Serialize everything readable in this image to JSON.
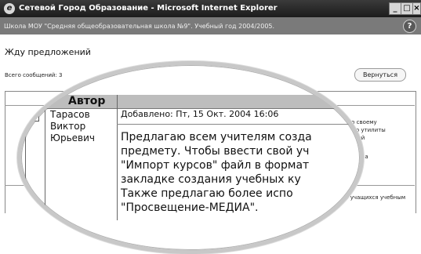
{
  "window": {
    "title": "Сетевой Город Образование - Microsoft Internet Explorer",
    "controls": [
      "_",
      "□",
      "×"
    ]
  },
  "header": {
    "school": "Школа МОУ \"Средняя общеобразовательная школа №9\". Учебный год 2004/2005.",
    "help_label": "?"
  },
  "page": {
    "title": "Жду предложений",
    "message_count": "Всего сообщений: 3",
    "back_label": "Вернуться"
  },
  "table": {
    "author_header": "Автор",
    "row": {
      "author_lines": [
        "Тарасов",
        "Виктор",
        "Юрьевич"
      ],
      "added": "Добавлено: Пт, 15 Окт. 2004 16:06",
      "message_lines": [
        "Предлагаю всем учителям созда",
        "предмету. Чтобы ввести свой уч",
        "\"Импорт курсов\" файл в формат",
        "закладке создания учебных ку",
        "Также предлагаю более испо",
        "\"Просвещение-МЕДИА\"."
      ]
    },
    "background_text": [
      "сы по своему",
      "мощью утилиты",
      "на самой",
      "ательства",
      "сти учащихся учебным"
    ]
  }
}
